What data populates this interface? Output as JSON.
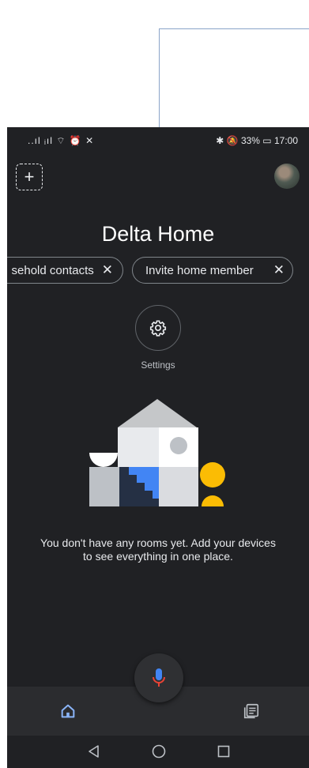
{
  "status_bar": {
    "left_icons": "..ıl ᵢıl ⌔ ⏰ ✕",
    "right_text": "✱ 🔕 33% ▭ 17:00"
  },
  "header": {
    "add_label": "+",
    "title": "Delta Home"
  },
  "chips": [
    {
      "label": "Household contacts",
      "visible_label": "sehold contacts",
      "close": "✕"
    },
    {
      "label": "Invite home member",
      "close": "✕"
    }
  ],
  "settings": {
    "label": "Settings"
  },
  "empty_state": {
    "message": "You don't have any rooms yet. Add your devices to see everything in one place."
  },
  "colors": {
    "background": "#202124",
    "nav_active": "#8ab4f8",
    "mic_blue": "#4285f4",
    "mic_red": "#ea4335",
    "accent_yellow": "#fbbc04"
  },
  "icons": [
    "add-home-icon",
    "avatar",
    "gear-icon",
    "mic-icon",
    "home-icon",
    "feed-icon",
    "back-icon",
    "home-circle-icon",
    "recents-icon"
  ]
}
